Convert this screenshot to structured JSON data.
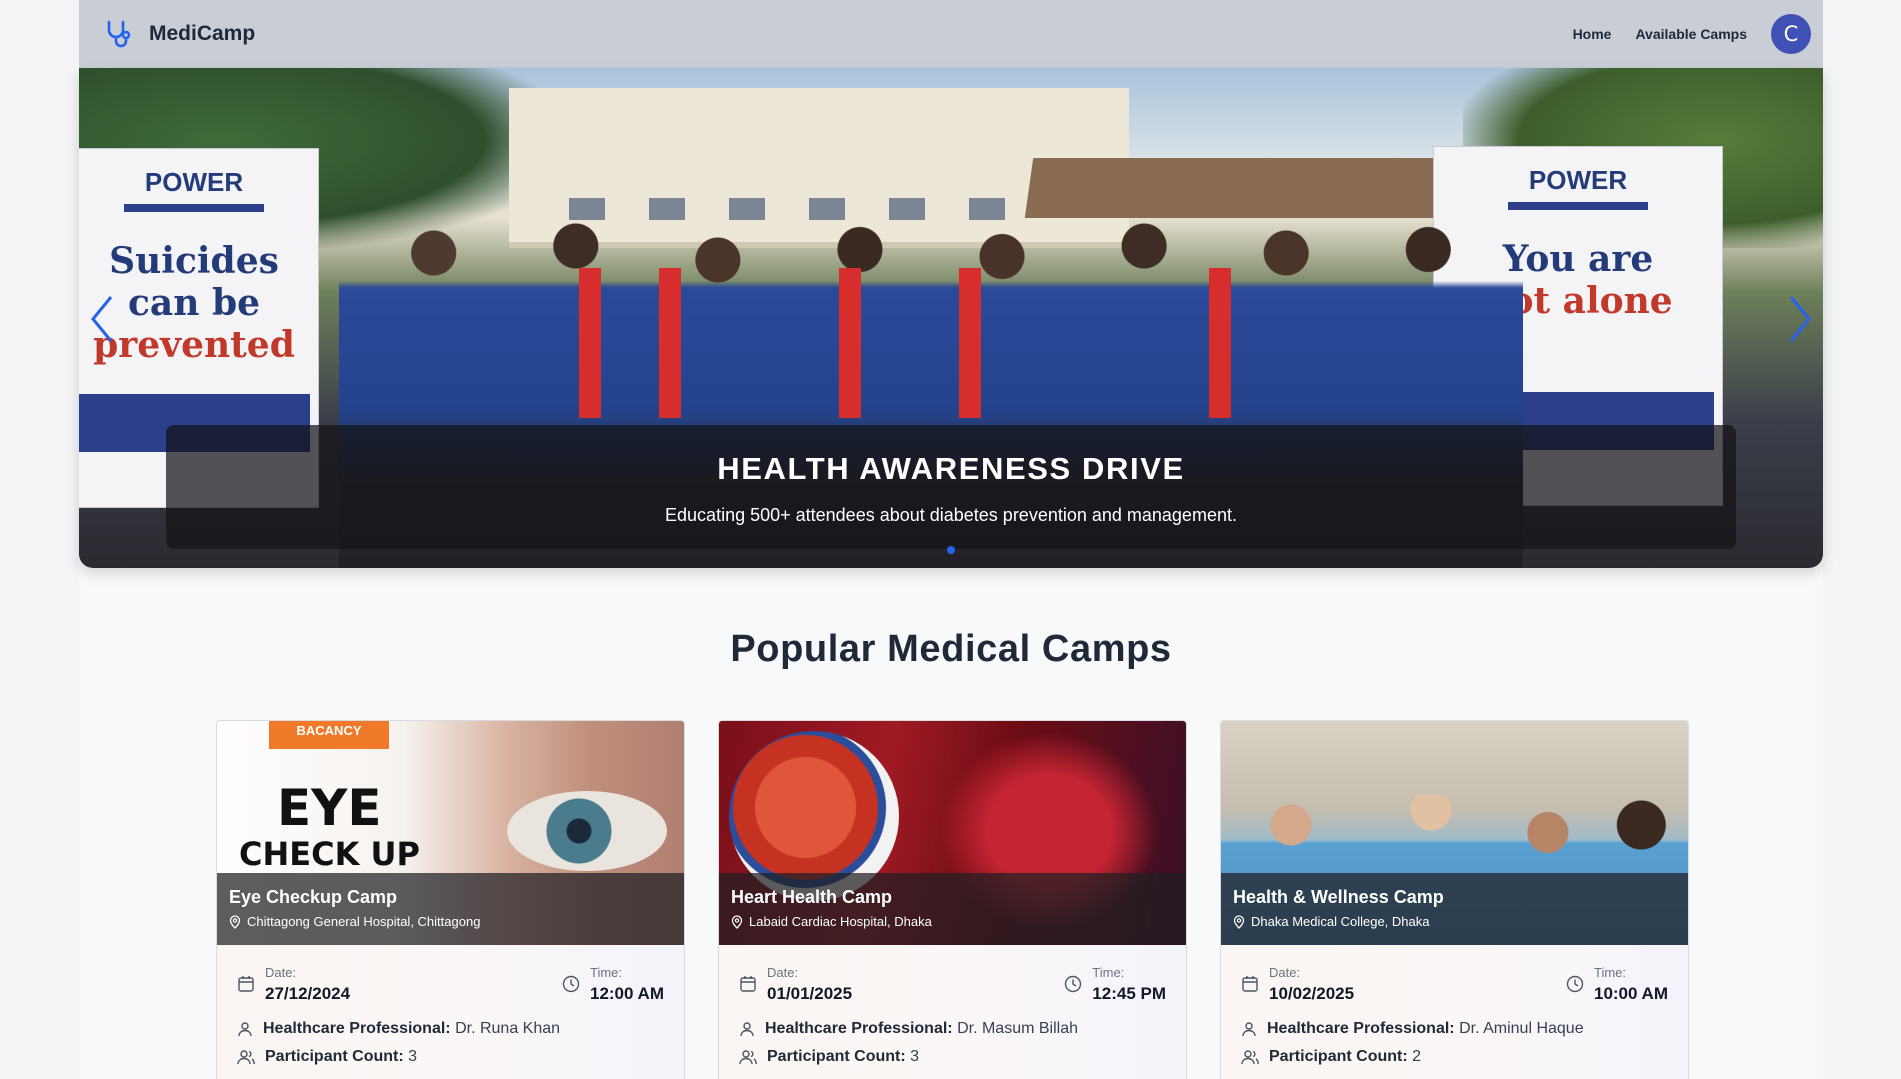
{
  "navbar": {
    "brand": "MediCamp",
    "links": [
      "Home",
      "Available Camps"
    ],
    "avatar_initial": "C"
  },
  "hero": {
    "title": "HEALTH AWARENESS DRIVE",
    "subtitle": "Educating 500+ attendees about diabetes prevention and management.",
    "banner_left": {
      "brand": "POWER",
      "line1": "Suicides can be",
      "line2": "prevented"
    },
    "banner_right": {
      "brand": "POWER",
      "line1": "You are",
      "line2": "not alone"
    }
  },
  "section": {
    "title": "Popular Medical Camps"
  },
  "cards": [
    {
      "name": "Eye Checkup Camp",
      "location": "Chittagong General Hospital, Chittagong",
      "date_label": "Date:",
      "date": "27/12/2024",
      "time_label": "Time:",
      "time": "12:00 AM",
      "professional_label": "Healthcare Professional:",
      "professional": "Dr. Runa Khan",
      "participants_label": "Participant Count:",
      "participants": "3",
      "image_text": {
        "badge": "BACANCY",
        "line1": "EYE",
        "line2": "CHECK UP"
      }
    },
    {
      "name": "Heart Health Camp",
      "location": "Labaid Cardiac Hospital, Dhaka",
      "date_label": "Date:",
      "date": "01/01/2025",
      "time_label": "Time:",
      "time": "12:45 PM",
      "professional_label": "Healthcare Professional:",
      "professional": "Dr. Masum Billah",
      "participants_label": "Participant Count:",
      "participants": "3"
    },
    {
      "name": "Health & Wellness Camp",
      "location": "Dhaka Medical College, Dhaka",
      "date_label": "Date:",
      "date": "10/02/2025",
      "time_label": "Time:",
      "time": "10:00 AM",
      "professional_label": "Healthcare Professional:",
      "professional": "Dr. Aminul Haque",
      "participants_label": "Participant Count:",
      "participants": "2"
    }
  ],
  "colors": {
    "navbar": "#c9ced6",
    "accent": "#2563eb",
    "avatar": "#3f51b5"
  }
}
